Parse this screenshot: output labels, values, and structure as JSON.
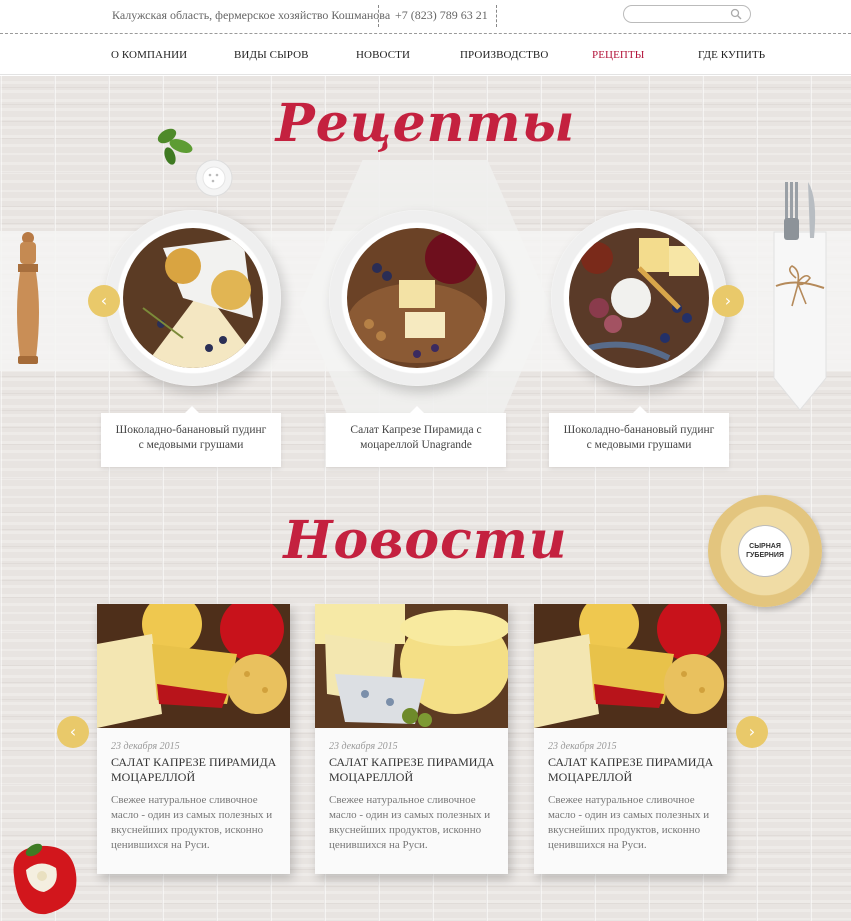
{
  "header": {
    "address": "Калужская область, фермерское хозяйство Кошманова",
    "phone": "+7 (823) 789 63 21",
    "search": {
      "placeholder": ""
    }
  },
  "nav": {
    "items": [
      {
        "label": "О КОМПАНИИ",
        "active": false
      },
      {
        "label": "ВИДЫ СЫРОВ",
        "active": false
      },
      {
        "label": "НОВОСТИ",
        "active": false
      },
      {
        "label": "ПРОИЗВОДСТВО",
        "active": false
      },
      {
        "label": "РЕЦЕПТЫ",
        "active": true
      },
      {
        "label": "ГДЕ КУПИТЬ",
        "active": false
      }
    ]
  },
  "recipes": {
    "title": "Рецепты",
    "items": [
      {
        "caption_line1": "Шоколадно-банановый пудинг",
        "caption_line2": "с медовыми грушами"
      },
      {
        "caption_line1": "Салат Капрезе Пирамида с",
        "caption_line2": "моцареллой Unagrande"
      },
      {
        "caption_line1": "Шоколадно-банановый пудинг",
        "caption_line2": "с медовыми грушами"
      }
    ],
    "prev_arrow": "‹",
    "next_arrow": "›"
  },
  "news": {
    "title": "Новости",
    "items": [
      {
        "date": "23 декабря 2015",
        "title": "САЛАТ КАПРЕЗЕ ПИРАМИДА МОЦАРЕЛЛОЙ",
        "text": "Свежее натуральное сливочное масло - один из самых полезных и вкуснейших продуктов, исконно ценившихся на Руси."
      },
      {
        "date": "23 декабря 2015",
        "title": "САЛАТ КАПРЕЗЕ ПИРАМИДА МОЦАРЕЛЛОЙ",
        "text": "Свежее натуральное сливочное масло - один из самых полезных и вкуснейших продуктов, исконно ценившихся на Руси."
      },
      {
        "date": "23 декабря 2015",
        "title": "САЛАТ КАПРЕЗЕ ПИРАМИДА МОЦАРЕЛЛОЙ",
        "text": "Свежее натуральное сливочное масло - один из самых полезных и вкуснейших продуктов, исконно ценившихся на Руси."
      }
    ],
    "prev_arrow": "‹",
    "next_arrow": "›"
  },
  "badge": {
    "text_line1": "СЫРНАЯ",
    "text_line2": "ГУБЕРНИЯ"
  },
  "colors": {
    "accent": "#c4213f",
    "arrow": "#e9c96a",
    "active_nav": "#b3143a"
  }
}
